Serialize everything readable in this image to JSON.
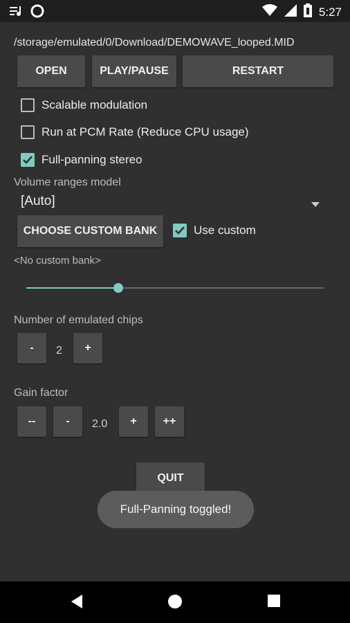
{
  "status_bar": {
    "time": "5:27",
    "icons": [
      "playlist-icon",
      "circle-icon",
      "wifi-icon",
      "signal-icon",
      "battery-icon"
    ]
  },
  "file_path": "/storage/emulated/0/Download/DEMOWAVE_looped.MID",
  "buttons": {
    "open": "OPEN",
    "play_pause": "PLAY/PAUSE",
    "restart": "RESTART",
    "choose_bank": "CHOOSE CUSTOM BANK",
    "quit": "QUIT"
  },
  "options": {
    "scalable_modulation": {
      "label": "Scalable modulation",
      "checked": false
    },
    "pcm_rate": {
      "label": "Run at PCM Rate (Reduce CPU usage)",
      "checked": false
    },
    "full_panning": {
      "label": "Full-panning stereo",
      "checked": true
    },
    "use_custom": {
      "label": "Use custom",
      "checked": true
    }
  },
  "volume_model": {
    "label": "Volume ranges model",
    "value": "[Auto]"
  },
  "custom_bank_text": "<No custom bank>",
  "slider": {
    "fraction": 0.31
  },
  "chips": {
    "label": "Number of emulated chips",
    "minus": "-",
    "value": "2",
    "plus": "+"
  },
  "gain": {
    "label": "Gain factor",
    "minus_minus": "--",
    "minus": "-",
    "value": "2.0",
    "plus": "+",
    "plus_plus": "++"
  },
  "toast": "Full-Panning toggled!",
  "colors": {
    "accent": "#80cbc4",
    "background": "#303030",
    "button": "#4a4a4a"
  }
}
